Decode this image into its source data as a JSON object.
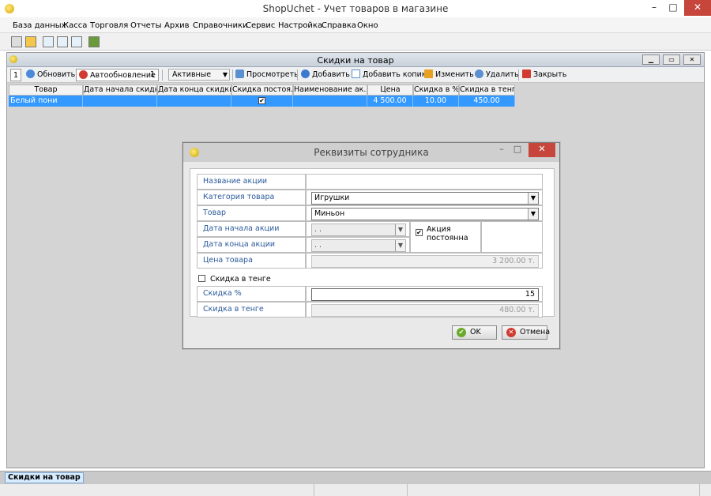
{
  "app": {
    "title": "ShopUchet - Учет товаров в магазине",
    "min_glyph": "–",
    "max_glyph": "□",
    "close_glyph": "✕"
  },
  "menu": [
    "База данных",
    "Касса",
    "Торговля",
    "Отчеты",
    "Архив",
    "Справочники",
    "Сервис",
    "Настройка",
    "Справка",
    "Окно"
  ],
  "child": {
    "title": "Скидки на товар",
    "toolbar": {
      "page_count": "1",
      "refresh": "Обновить",
      "autorefresh": "Автообновление",
      "autorefresh_value": "1",
      "filter_value": "Активные",
      "view": "Просмотреть",
      "add": "Добавить",
      "add_copy": "Добавить копию",
      "edit": "Изменить",
      "delete": "Удалить",
      "close": "Закрыть"
    },
    "columns": [
      "Товар",
      "Дата начала скидки",
      "Дата конца скидки",
      "Скидка постоя...",
      "Наименование ак...",
      "Цена",
      "Скидка в %",
      "Скидка в тенге"
    ],
    "rows": [
      {
        "product": "Белый пони",
        "start": "",
        "end": "",
        "permanent": true,
        "name": "",
        "price": "4 500.00",
        "discount_pct": "10.00",
        "discount_tenge": "450.00"
      }
    ]
  },
  "dialog": {
    "title": "Реквизиты сотрудника",
    "labels": {
      "promo_name": "Название акции",
      "category": "Категория товара",
      "product": "Товар",
      "start_date": "Дата начала акции",
      "end_date": "Дата конца акции",
      "price": "Цена товара",
      "discount_tenge_toggle": "Скидка в тенге",
      "discount_pct": "Скидка %",
      "discount_tenge": "Скидка в тенге",
      "permanent": "Акция постоянна"
    },
    "values": {
      "promo_name": "",
      "category": "Игрушки",
      "product": "Миньон",
      "start_date": " .  .",
      "end_date": " .  .",
      "price": "3 200.00 т.",
      "discount_pct": "15",
      "discount_tenge": "480.00 т.",
      "permanent_checked": true,
      "discount_tenge_checked": false
    },
    "buttons": {
      "ok": "OK",
      "cancel": "Отмена"
    }
  },
  "taskbar": {
    "active_window": "Скидки на товар"
  },
  "colors": {
    "selection": "#3399ff",
    "close_red": "#c7463c",
    "label_blue": "#2a5a9a"
  }
}
